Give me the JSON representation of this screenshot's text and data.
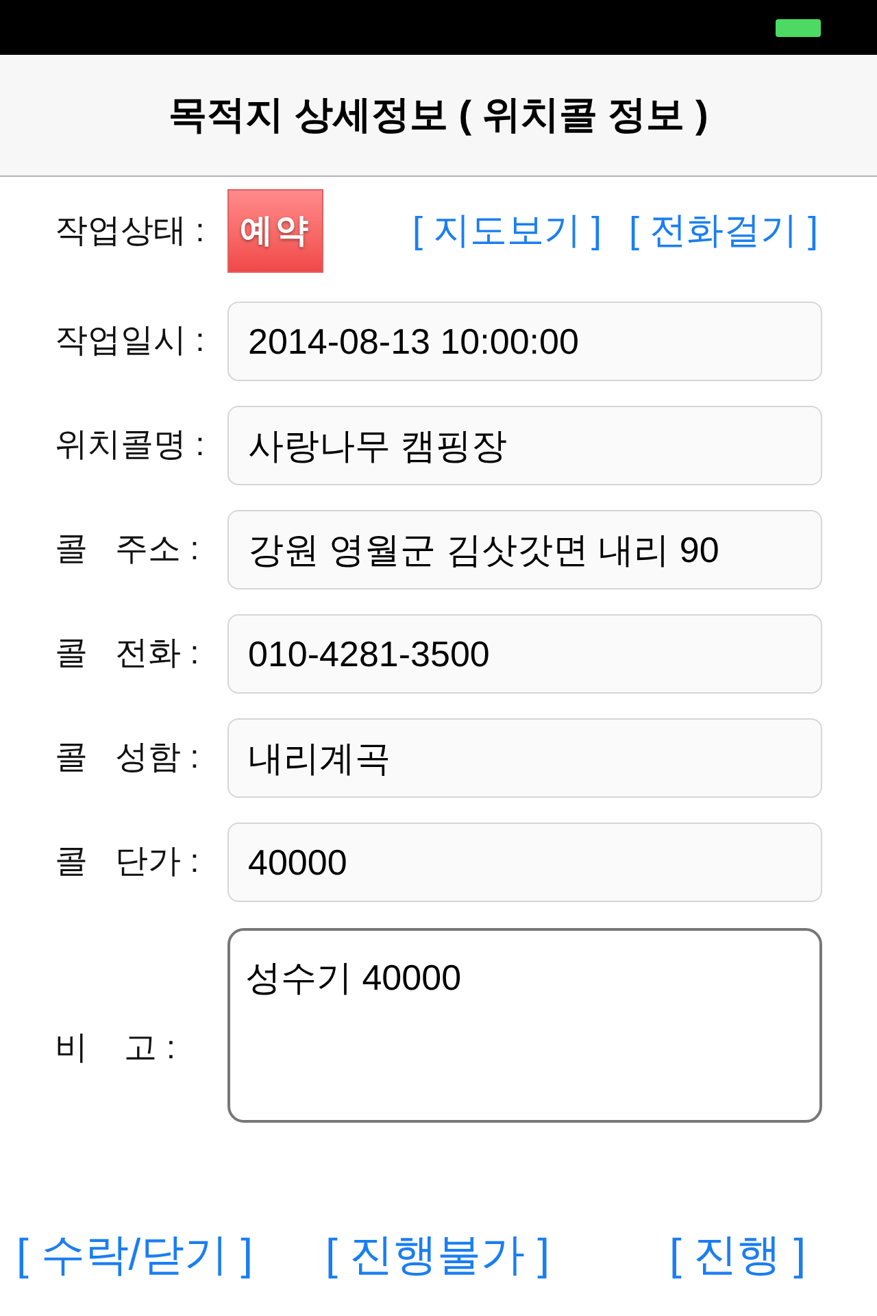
{
  "nav": {
    "title": "목적지 상세정보 ( 위치콜 정보 )"
  },
  "status_row": {
    "label": "작업상태 :",
    "badge": "예약",
    "links": [
      "[ 지도보기 ]",
      "[ 전화걸기 ]"
    ]
  },
  "fields": [
    {
      "label": "작업일시 :",
      "value": "2014-08-13 10:00:00"
    },
    {
      "label": "위치콜명 :",
      "value": "사랑나무 캠핑장"
    },
    {
      "label": "콜   주소 :",
      "value": "강원 영월군 김삿갓면 내리 90"
    },
    {
      "label": "콜   전화 :",
      "value": "010-4281-3500"
    },
    {
      "label": "콜   성함 :",
      "value": "내리계곡"
    },
    {
      "label": "콜   단가 :",
      "value": "40000"
    }
  ],
  "memo": {
    "label": "비    고 :",
    "value": "성수기 40000"
  },
  "buttons": [
    "[ 수락/닫기 ]",
    "[ 진행불가 ]",
    "[ 진행 ]"
  ]
}
